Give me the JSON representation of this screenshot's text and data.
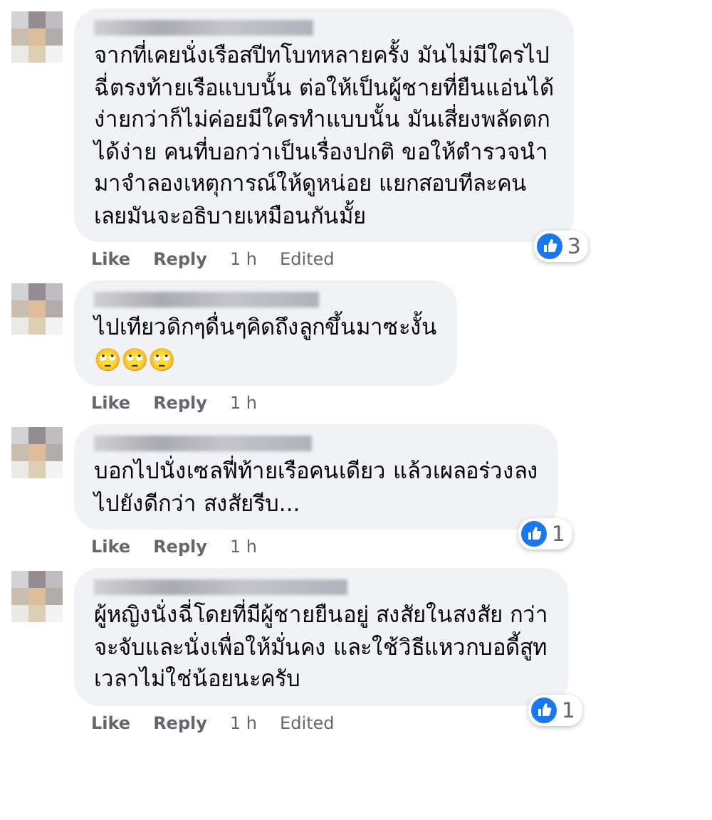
{
  "comments": [
    {
      "text": "จากที่เคยนั่งเรือสปีทโบทหลายครั้ง มันไม่มีใครไป\nฉี่ตรงท้ายเรือแบบนั้น ต่อให้เป็นผู้ชายที่ยืนแอ่นได้\nง่ายกว่าก็ไม่ค่อยมีใครทำแบบนั้น มันเสี่ยงพลัดตก\nได้ง่าย คนที่บอกว่าเป็นเรื่องปกติ ขอให้ตำรวจนำ\nมาจำลองเหตุการณ์ให้ดูหน่อย แยกสอบทีละคน\nเลยมันจะอธิบายเหมือนกันมั้ย",
      "reactions": "3",
      "like": "Like",
      "reply": "Reply",
      "time": "1 h",
      "edited": "Edited"
    },
    {
      "text": "ไปเทียวดิกๆดื่นๆคิดถึงลูกขึ้นมาซะงั้น\n🙄🙄🙄",
      "like": "Like",
      "reply": "Reply",
      "time": "1 h"
    },
    {
      "text": "บอกไปนั่งเซลฟี่ท้ายเรือคนเดียว แล้วเผลอร่วงลง\nไปยังดีกว่า สงสัยรีบ...",
      "reactions": "1",
      "like": "Like",
      "reply": "Reply",
      "time": "1 h"
    },
    {
      "text": "ผู้หญิงนั่งฉี่โดยที่มีผู้ชายยืนอยู่ สงสัยในสงสัย กว่า\nจะจับและนั่งเพื่อให้มั่นคง และใช้วิธีแหวกบอดี้สูท\nเวลาไม่ใช่น้อยนะครับ",
      "reactions": "1",
      "like": "Like",
      "reply": "Reply",
      "time": "1 h",
      "edited": "Edited"
    }
  ]
}
